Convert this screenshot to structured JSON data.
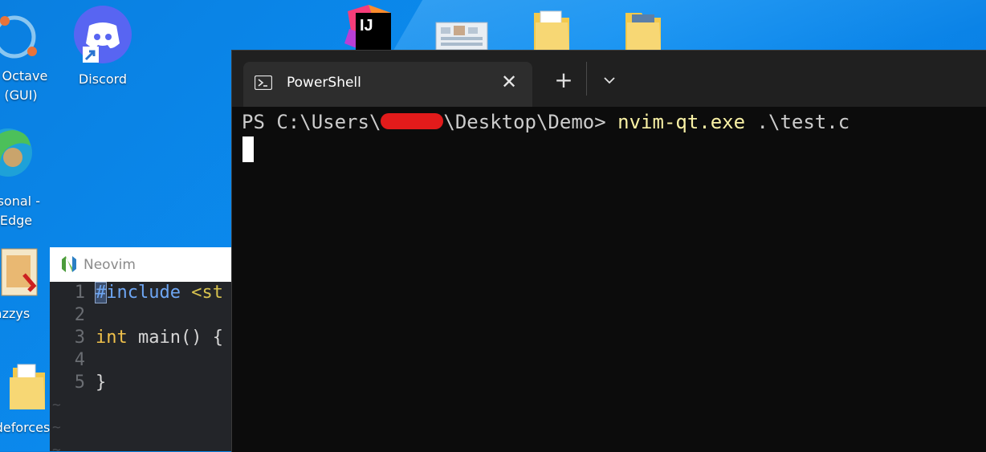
{
  "desktop": {
    "icons": [
      {
        "label_line1": "J Octave",
        "label_line2": "(GUI)"
      },
      {
        "label_line1": "Discord",
        "label_line2": ""
      },
      {
        "label_line1": "rsonal -",
        "label_line2": "Edge"
      },
      {
        "label_line1": "azzys",
        "label_line2": ""
      },
      {
        "label_line1": "deforces",
        "label_line2": ""
      }
    ],
    "top_icons": {
      "intellij_text": "IJ"
    }
  },
  "terminal": {
    "tab_title": "PowerShell",
    "close_glyph": "✕",
    "new_tab_glyph": "+",
    "prompt_prefix": "PS C:\\Users\\",
    "prompt_suffix": "\\Desktop\\Demo>",
    "command": "nvim-qt.exe",
    "command_arg": ".\\test.c"
  },
  "neovim": {
    "title": "Neovim",
    "lines": [
      {
        "num": "1",
        "text": "#include <st"
      },
      {
        "num": "2",
        "text": ""
      },
      {
        "num": "3",
        "text": "int main() {"
      },
      {
        "num": "4",
        "text": ""
      },
      {
        "num": "5",
        "text": "}"
      }
    ],
    "tilde": "~"
  },
  "colors": {
    "desktop_bg": "#0b8cf0",
    "terminal_bg": "#0c0c0c",
    "command_yellow": "#f9f1a5",
    "neovim_bg": "#232529"
  }
}
